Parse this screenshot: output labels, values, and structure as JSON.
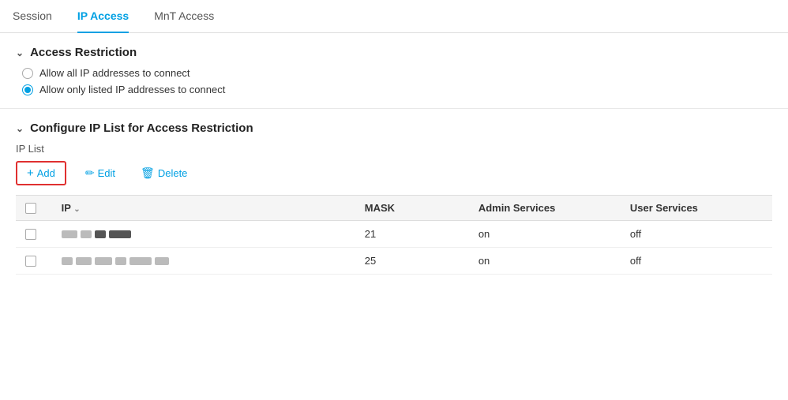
{
  "tabs": [
    {
      "id": "session",
      "label": "Session",
      "active": false
    },
    {
      "id": "ip-access",
      "label": "IP Access",
      "active": true
    },
    {
      "id": "mnt-access",
      "label": "MnT Access",
      "active": false
    }
  ],
  "access_restriction": {
    "title": "Access Restriction",
    "options": [
      {
        "id": "allow-all",
        "label": "Allow all IP addresses to connect",
        "selected": false
      },
      {
        "id": "allow-listed",
        "label": "Allow only listed IP addresses to connect",
        "selected": true
      }
    ]
  },
  "ip_list_section": {
    "title": "Configure IP List for Access Restriction",
    "sublabel": "IP List",
    "toolbar": {
      "add_label": "Add",
      "edit_label": "Edit",
      "delete_label": "Delete"
    },
    "table": {
      "columns": [
        {
          "id": "checkbox",
          "label": ""
        },
        {
          "id": "ip",
          "label": "IP",
          "sortable": true
        },
        {
          "id": "mask",
          "label": "MASK"
        },
        {
          "id": "admin",
          "label": "Admin Services"
        },
        {
          "id": "user",
          "label": "User Services"
        }
      ],
      "rows": [
        {
          "id": 1,
          "mask": "21",
          "admin": "on",
          "user": "off"
        },
        {
          "id": 2,
          "mask": "25",
          "admin": "on",
          "user": "off"
        }
      ]
    }
  }
}
